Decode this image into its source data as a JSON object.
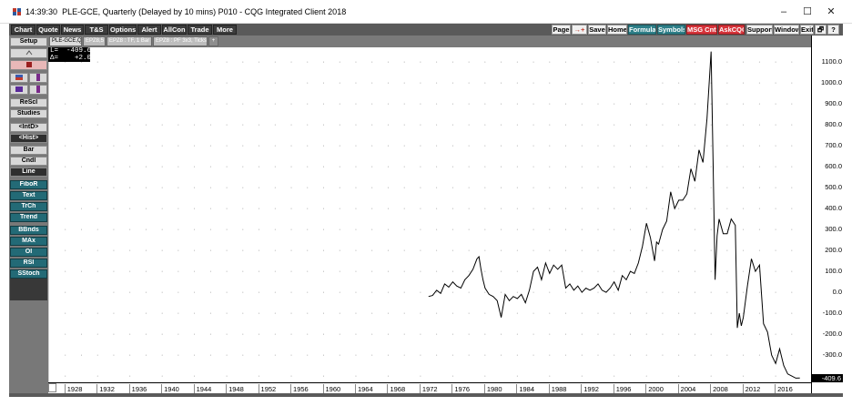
{
  "window": {
    "time": "14:39:30",
    "title": "PLE-GCE, Quarterly (Delayed by 10 mins)  P010 - CQG Integrated Client 2018",
    "minimize": "–",
    "maximize": "☐",
    "close": "✕"
  },
  "toolbar": {
    "left": [
      "Chart",
      "Quote",
      "News",
      "T&S",
      "Options",
      "Alert",
      "AllCon",
      "Trade",
      "More"
    ],
    "page": "Page",
    "arrow": "→+",
    "save": "Save",
    "home": "Home",
    "formula": "Formula",
    "symbols": "Symbols",
    "msg": "MSG Cntr",
    "askcqg": "AskCQG",
    "support": "Support",
    "window": "Window",
    "exit": "Exit",
    "restore": "🗗",
    "help": "?"
  },
  "sidebar": {
    "setup": "Setup",
    "rescl": "ReScl",
    "studies": "Studies",
    "intd": "<IntD>",
    "hist": "<Hist>",
    "bar": "Bar",
    "cndl": "Cndl",
    "line": "Line",
    "fibor": "FiboR",
    "text": "Text",
    "trch": "TrCh",
    "trend": "Trend",
    "bbnds": "BBnds",
    "max": "MAx",
    "oi": "OI",
    "rsi": "RSI",
    "sstoch": "SStoch"
  },
  "tabs": [
    "PLE-GCE,Q",
    "EPZ8,5",
    "EPZ8 : TF, 1 Bar",
    "EPZ8 : PF 3x3, Ticks",
    "+"
  ],
  "cursor": {
    "line1": "L=  -409.6",
    "line2": "Δ=    +2.0"
  },
  "yaxis": {
    "ticks": [
      "1100.0",
      "1000.0",
      "900.0",
      "800.0",
      "700.0",
      "600.0",
      "500.0",
      "400.0",
      "300.0",
      "200.0",
      "100.0",
      "0.0",
      "-100.0",
      "-200.0",
      "-300.0"
    ],
    "last": "-409.6"
  },
  "xaxis": {
    "ticks": [
      "1928",
      "1932",
      "1936",
      "1940",
      "1944",
      "1948",
      "1952",
      "1956",
      "1960",
      "1964",
      "1968",
      "1972",
      "1976",
      "1980",
      "1984",
      "1988",
      "1992",
      "1996",
      "2000",
      "2004",
      "2008",
      "2012",
      "2016"
    ]
  },
  "chart_data": {
    "type": "line",
    "title": "PLE-GCE, Quarterly",
    "xlabel": "",
    "ylabel": "",
    "xlim": [
      1926,
      2020.5
    ],
    "ylim": [
      -430,
      1170
    ],
    "grid": "dotted",
    "series": [
      {
        "name": "PLE-GCE",
        "x": [
          1973.0,
          1973.5,
          1974.0,
          1974.5,
          1975.0,
          1975.5,
          1976.0,
          1976.5,
          1977.0,
          1977.5,
          1978.0,
          1978.5,
          1979.0,
          1979.25,
          1979.5,
          1979.75,
          1980.0,
          1980.5,
          1981.0,
          1981.5,
          1982.0,
          1982.5,
          1983.0,
          1983.5,
          1984.0,
          1984.5,
          1985.0,
          1985.5,
          1986.0,
          1986.5,
          1987.0,
          1987.5,
          1988.0,
          1988.5,
          1989.0,
          1989.5,
          1990.0,
          1990.5,
          1991.0,
          1991.5,
          1992.0,
          1992.5,
          1993.0,
          1993.5,
          1994.0,
          1994.5,
          1995.0,
          1995.5,
          1996.0,
          1996.5,
          1997.0,
          1997.5,
          1998.0,
          1998.5,
          1999.0,
          1999.5,
          2000.0,
          2000.5,
          2001.0,
          2001.25,
          2001.5,
          2002.0,
          2002.5,
          2003.0,
          2003.5,
          2004.0,
          2004.5,
          2005.0,
          2005.5,
          2006.0,
          2006.5,
          2007.0,
          2007.5,
          2008.0,
          2008.25,
          2008.5,
          2008.75,
          2009.0,
          2009.5,
          2010.0,
          2010.5,
          2011.0,
          2011.25,
          2011.5,
          2011.75,
          2012.0,
          2012.5,
          2013.0,
          2013.5,
          2014.0,
          2014.5,
          2015.0,
          2015.5,
          2016.0,
          2016.5,
          2017.0,
          2017.5,
          2018.0,
          2018.5,
          2019.0
        ],
        "values": [
          -20,
          -15,
          10,
          -5,
          40,
          25,
          50,
          30,
          20,
          60,
          80,
          110,
          160,
          170,
          110,
          60,
          20,
          -10,
          -20,
          -40,
          -120,
          -10,
          -40,
          -20,
          -30,
          -10,
          -50,
          10,
          100,
          120,
          60,
          140,
          90,
          130,
          110,
          130,
          20,
          40,
          10,
          30,
          0,
          20,
          10,
          20,
          40,
          10,
          0,
          20,
          50,
          10,
          80,
          60,
          100,
          90,
          140,
          220,
          330,
          260,
          150,
          240,
          230,
          300,
          340,
          480,
          400,
          440,
          440,
          470,
          590,
          530,
          680,
          620,
          830,
          1150,
          620,
          60,
          270,
          350,
          280,
          280,
          350,
          320,
          -170,
          -100,
          -160,
          -120,
          30,
          160,
          100,
          130,
          -150,
          -190,
          -300,
          -340,
          -270,
          -350,
          -390,
          -400,
          -410,
          -409.6
        ]
      }
    ]
  },
  "colors": {
    "toolbar_bg": "#5a5a5a",
    "teal_button": "#2e7f88",
    "red_button": "#d6333a",
    "line": "#000000"
  }
}
